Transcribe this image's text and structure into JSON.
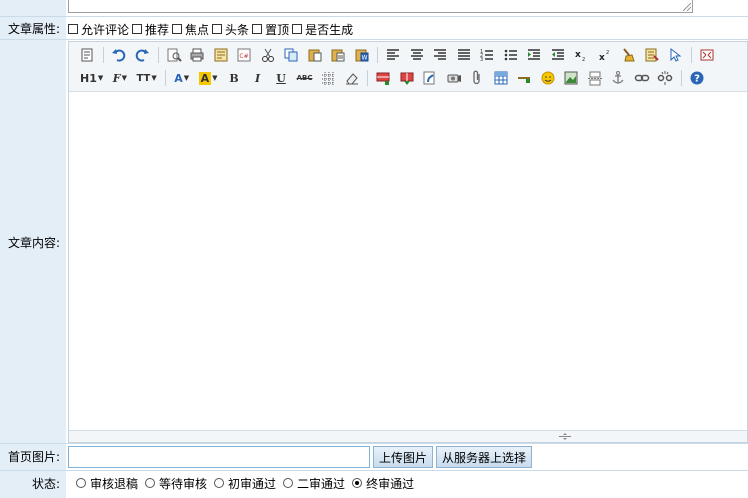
{
  "labels": {
    "attributes": "文章属性:",
    "content": "文章内容:",
    "homepage_image": "首页图片:",
    "status": "状态:"
  },
  "attributes": [
    {
      "label": "允许评论",
      "checked": false
    },
    {
      "label": "推荐",
      "checked": false
    },
    {
      "label": "焦点",
      "checked": false
    },
    {
      "label": "头条",
      "checked": false
    },
    {
      "label": "置顶",
      "checked": false
    },
    {
      "label": "是否生成",
      "checked": false
    }
  ],
  "toolbar": {
    "row1": [
      "source-icon",
      "undo-icon",
      "redo-icon",
      "preview-icon",
      "print-icon",
      "template-icon",
      "code-icon",
      "cut-icon",
      "copy-icon",
      "paste-icon",
      "paste-text-icon",
      "paste-word-icon",
      "align-left-icon",
      "align-center-icon",
      "align-right-icon",
      "align-justify-icon",
      "ordered-list-icon",
      "unordered-list-icon",
      "indent-icon",
      "outdent-icon",
      "subscript-icon",
      "superscript-icon",
      "clear-format-icon",
      "select-all-icon",
      "cursor-icon",
      "fullscreen-icon"
    ],
    "heading_label": "H1",
    "font_label": "F",
    "size_label": "TT",
    "font_color_label": "A",
    "highlight_label": "A",
    "bold_label": "B",
    "italic_label": "I",
    "underline_label": "U",
    "strike_label": "ABC"
  },
  "homepage_image": {
    "value": "",
    "upload_button": "上传图片",
    "server_button": "从服务器上选择"
  },
  "status_options": [
    {
      "label": "审核退稿",
      "selected": false
    },
    {
      "label": "等待审核",
      "selected": false
    },
    {
      "label": "初审通过",
      "selected": false
    },
    {
      "label": "二审通过",
      "selected": false
    },
    {
      "label": "终审通过",
      "selected": true
    }
  ],
  "colors": {
    "label_column": "#e3eef7",
    "input_border": "#7eb4dc",
    "button_bg": "#c8dcee"
  }
}
